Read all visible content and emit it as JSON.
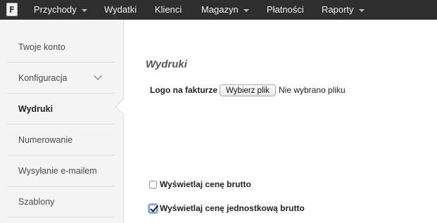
{
  "logo": {
    "letter": "F"
  },
  "nav": {
    "items": [
      {
        "label": "Przychody",
        "has_dropdown": true
      },
      {
        "label": "Wydatki",
        "has_dropdown": false
      },
      {
        "label": "Klienci",
        "has_dropdown": false
      },
      {
        "label": "Magazyn",
        "has_dropdown": true
      },
      {
        "label": "Płatności",
        "has_dropdown": false
      },
      {
        "label": "Raporty",
        "has_dropdown": true
      }
    ]
  },
  "sidebar": {
    "items": [
      {
        "label": "Twoje konto"
      },
      {
        "label": "Konfiguracja",
        "expandable": true
      },
      {
        "label": "Wydruki",
        "active": true
      },
      {
        "label": "Numerowanie"
      },
      {
        "label": "Wysyłanie e-mailem"
      },
      {
        "label": "Szablony"
      }
    ]
  },
  "main": {
    "title": "Wydruki",
    "logo_field": {
      "label": "Logo na fakturze",
      "button_label": "Wybierz plik",
      "status": "Nie wybrano pliku"
    },
    "checkboxes": [
      {
        "label": "Wyświetlaj cenę brutto",
        "checked": false
      },
      {
        "label": "Wyświetlaj cenę jednostkową brutto",
        "checked": true
      }
    ]
  }
}
